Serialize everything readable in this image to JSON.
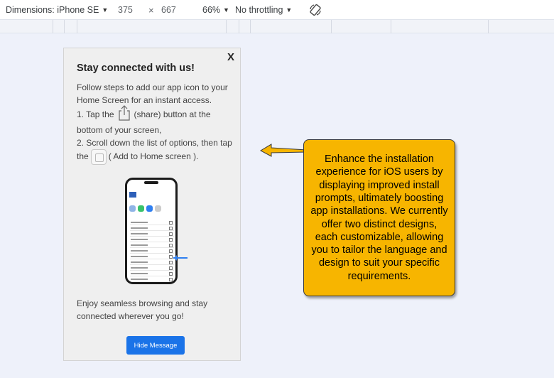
{
  "toolbar": {
    "dimensions_label": "Dimensions: iPhone SE",
    "width": "375",
    "times": "×",
    "height": "667",
    "zoom": "66%",
    "throttling": "No throttling",
    "rotate_icon": "rotate-icon"
  },
  "prompt": {
    "close_label": "X",
    "title": "Stay connected with us!",
    "intro": "Follow steps to add our app icon to your Home Screen for an instant access.",
    "step1_prefix": "1. Tap the",
    "step1_suffix": "(share) button at the bottom of your screen,",
    "step2_prefix": "2. Scroll down the list of options, then tap the",
    "step2_suffix": "( Add to Home screen ).",
    "footer": "Enjoy seamless browsing and stay connected wherever you go!",
    "hide_button": "Hide Message"
  },
  "callout": {
    "text": "Enhance the installation experience for iOS users by displaying improved install prompts, ultimately boosting app installations. We currently offer two distinct designs, each customizable, allowing you to tailor the language and design to suit your specific requirements.",
    "color": "#f7b500"
  }
}
